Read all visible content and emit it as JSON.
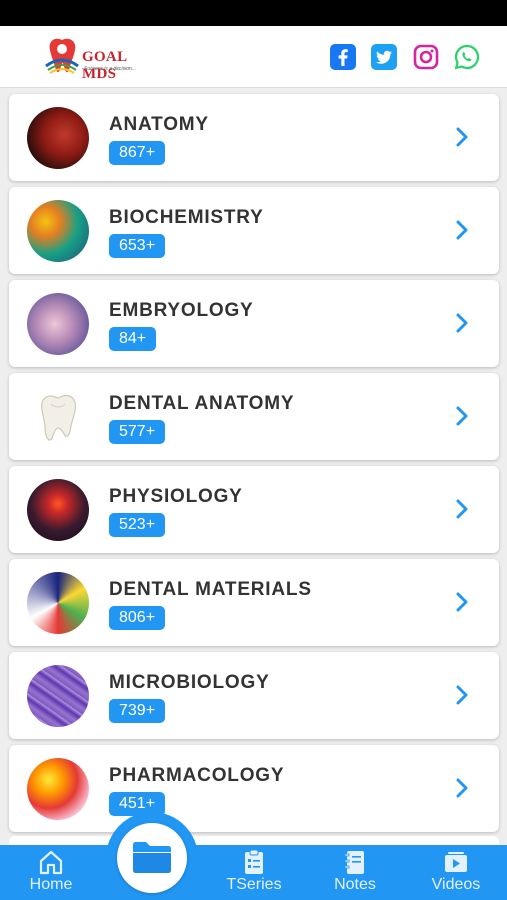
{
  "brand": {
    "name": "GOAL MDS",
    "tagline": "Success is a decision..."
  },
  "social": [
    "facebook-icon",
    "twitter-icon",
    "instagram-icon",
    "whatsapp-icon"
  ],
  "subjects": [
    {
      "title": "ANATOMY",
      "count": "867+",
      "image": "anatomy-thumbnail"
    },
    {
      "title": "BIOCHEMISTRY",
      "count": "653+",
      "image": "biochemistry-thumbnail"
    },
    {
      "title": "EMBRYOLOGY",
      "count": "84+",
      "image": "embryology-thumbnail"
    },
    {
      "title": "DENTAL ANATOMY",
      "count": "577+",
      "image": "dental-anatomy-thumbnail"
    },
    {
      "title": "PHYSIOLOGY",
      "count": "523+",
      "image": "physiology-thumbnail"
    },
    {
      "title": "DENTAL MATERIALS",
      "count": "806+",
      "image": "dental-materials-thumbnail"
    },
    {
      "title": "MICROBIOLOGY",
      "count": "739+",
      "image": "microbiology-thumbnail"
    },
    {
      "title": "PHARMACOLOGY",
      "count": "451+",
      "image": "pharmacology-thumbnail"
    }
  ],
  "nav": {
    "home": "Home",
    "tseries": "TSeries",
    "notes": "Notes",
    "videos": "Videos"
  },
  "colors": {
    "accent": "#2196f3",
    "facebook": "#1877f2",
    "twitter": "#1da1f2",
    "instagram": "#d6249f",
    "whatsapp": "#25d366"
  }
}
